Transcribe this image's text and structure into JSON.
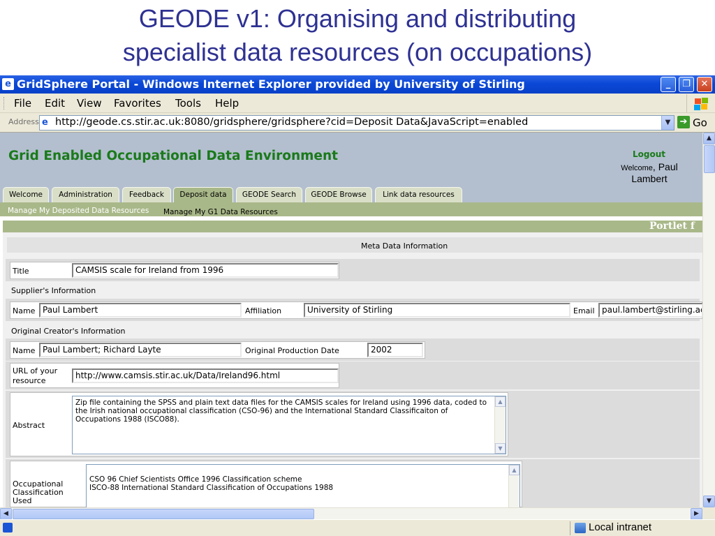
{
  "slide": {
    "title_line1": "GEODE v1: Organising and distributing",
    "title_line2": "specialist data resources (on occupations)"
  },
  "window": {
    "title": "GridSphere Portal - Windows Internet Explorer provided by University of Stirling",
    "menu": [
      "File",
      "Edit",
      "View",
      "Favorites",
      "Tools",
      "Help"
    ],
    "address_label": "Address",
    "url": "http://geode.cs.stir.ac.uk:8080/gridsphere/gridsphere?cid=Deposit Data&JavaScript=enabled",
    "go_label": "Go",
    "status_zone": "Local intranet"
  },
  "portal": {
    "title": "Grid Enabled Occupational Data Environment",
    "logout": "Logout",
    "welcome_word": "Welcome",
    "user": "Paul Lambert",
    "tabs": [
      "Welcome",
      "Administration",
      "Feedback",
      "Deposit data",
      "GEODE Search",
      "GEODE Browse",
      "Link data resources"
    ],
    "active_tab": "Deposit data",
    "subnav": [
      "Manage My Deposited Data Resources",
      "Manage My G1 Data Resources"
    ],
    "portlet_title": "Portlet f"
  },
  "form": {
    "section_header": "Meta Data Information",
    "title_label": "Title",
    "title_value": "CAMSIS scale for Ireland from 1996",
    "supplier_heading": "Supplier's Information",
    "name_label": "Name",
    "supplier_name": "Paul Lambert",
    "affiliation_label": "Affiliation",
    "affiliation_value": "University of Stirling",
    "email_label": "Email",
    "email_value": "paul.lambert@stirling.ac.uk",
    "creator_heading": "Original Creator's Information",
    "creator_name": "Paul Lambert; Richard Layte",
    "production_date_label": "Original Production Date",
    "production_date_value": "2002",
    "url_label": "URL of your resource",
    "url_value": "http://www.camsis.stir.ac.uk/Data/Ireland96.html",
    "abstract_label": "Abstract",
    "abstract_value": "Zip file containing the SPSS and plain text data files for the CAMSIS scales for Ireland using 1996 data, coded to the Irish national occupational classification (CSO-96) and the International Standard Classificaiton of Occupations 1988 (ISCO88).",
    "occ_class_label": "Occupational Classification Used",
    "occ_class_value": "CSO 96 Chief Scientists Office 1996 Classification scheme\nISCO-88 International Standard Classification of Occupations 1988"
  }
}
